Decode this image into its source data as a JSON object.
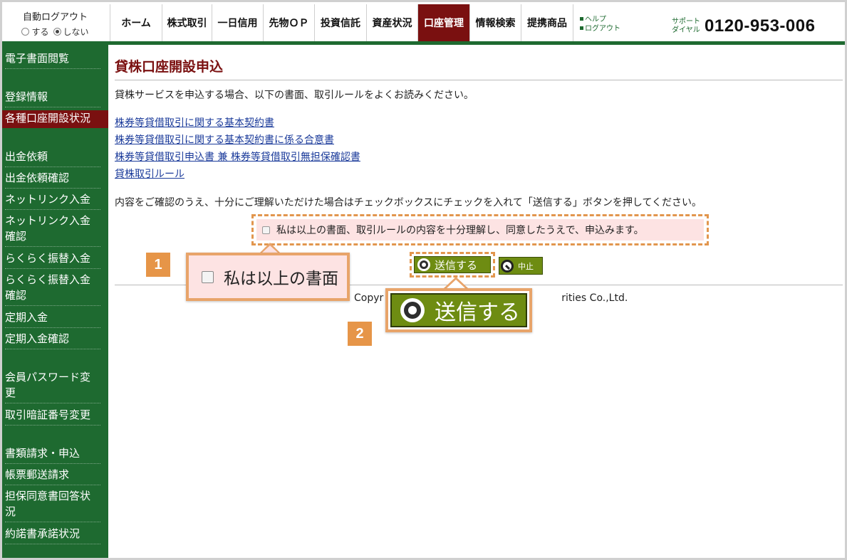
{
  "autologout": {
    "title": "自動ログアウト",
    "on_label": "する",
    "off_label": "しない"
  },
  "nav": [
    {
      "label": "ホーム",
      "w": 73
    },
    {
      "label": "株式取引",
      "w": 70
    },
    {
      "label": "一日信用",
      "w": 72
    },
    {
      "label": "先物ＯＰ",
      "w": 72
    },
    {
      "label": "投資信託",
      "w": 73
    },
    {
      "label": "資産状況",
      "w": 72
    },
    {
      "label": "口座管理",
      "w": 73
    },
    {
      "label": "情報検索",
      "w": 72
    },
    {
      "label": "提携商品",
      "w": 74
    }
  ],
  "help": {
    "help_label": "ヘルプ",
    "logout_label": "ログアウト"
  },
  "support": {
    "line1": "サポート",
    "line2": "ダイヤル",
    "phone": "0120-953-006"
  },
  "sidebar": {
    "items": [
      {
        "label": "電子書面閲覧"
      },
      {
        "label": "登録情報"
      },
      {
        "label": "各種口座開設状況"
      },
      {
        "label": "出金依頼"
      },
      {
        "label": "出金依頼確認"
      },
      {
        "label": "ネットリンク入金"
      },
      {
        "label": "ネットリンク入金確認"
      },
      {
        "label": "らくらく振替入金"
      },
      {
        "label": "らくらく振替入金確認"
      },
      {
        "label": "定期入金"
      },
      {
        "label": "定期入金確認"
      },
      {
        "label": "会員パスワード変更"
      },
      {
        "label": "取引暗証番号変更"
      },
      {
        "label": "書類請求・申込"
      },
      {
        "label": "帳票郵送請求"
      },
      {
        "label": "担保同意書回答状況"
      },
      {
        "label": "約諾書承諾状況"
      }
    ]
  },
  "main": {
    "title": "貸株口座開設申込",
    "intro": "貸株サービスを申込する場合、以下の書面、取引ルールをよくお読みください。",
    "links": [
      "株券等貸借取引に関する基本契約書",
      "株券等貸借取引に関する基本契約書に係る合意書",
      "株券等貸借取引申込書 兼 株券等貸借取引無担保確認書",
      "貸株取引ルール"
    ],
    "confirm_text": "内容をご確認のうえ、十分にご理解いただけた場合はチェックボックスにチェックを入れて「送信する」ボタンを押してください。",
    "agree_label": "私は以上の書面、取引ルールの内容を十分理解し、同意したうえで、申込みます。",
    "submit_label": "送信する",
    "cancel_label": "中止",
    "copyright_left": "Copyr",
    "copyright_right": "rities Co.,Ltd."
  },
  "callouts": {
    "badge1": "1",
    "badge2": "2",
    "zoom1_text": "私は以上の書面",
    "zoom2_text": "送信する"
  },
  "colors": {
    "green": "#1e6a30",
    "maroon": "#7a1010",
    "button": "#6e8c12",
    "orange": "#e69548"
  }
}
